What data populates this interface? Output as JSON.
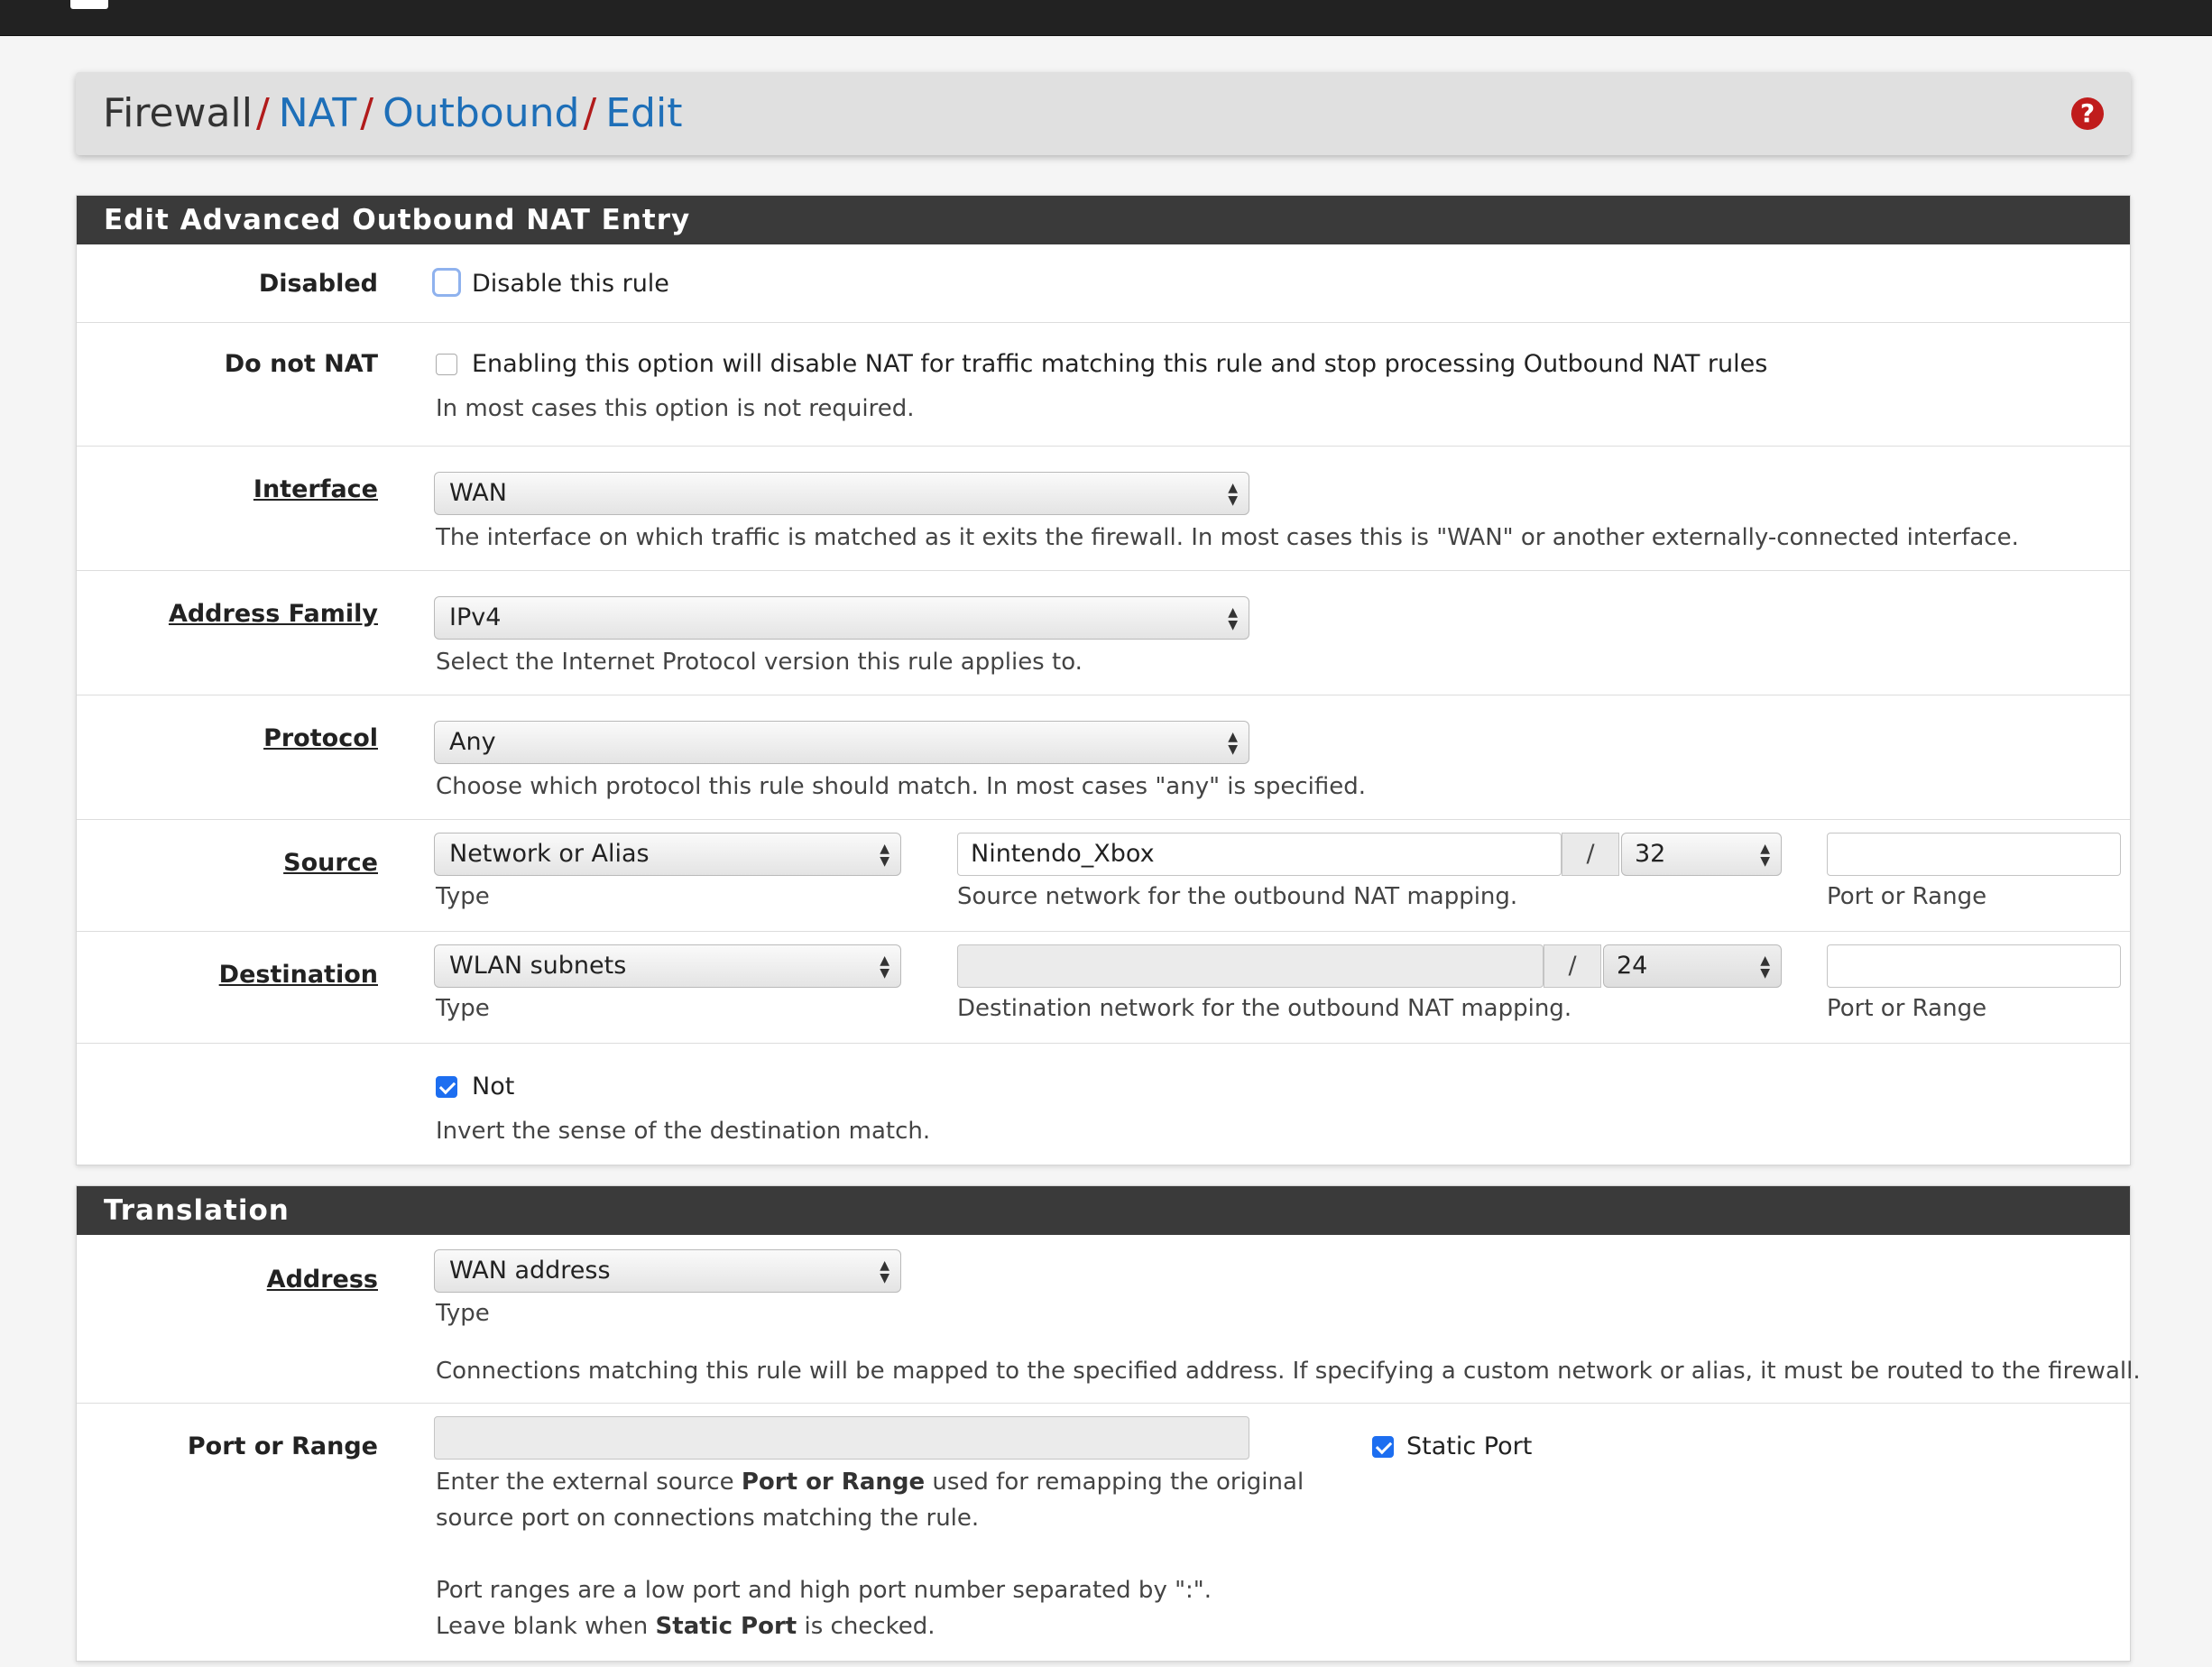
{
  "breadcrumb": {
    "items": [
      "Firewall",
      "NAT",
      "Outbound",
      "Edit"
    ],
    "separator": "/"
  },
  "panel_main": {
    "title": "Edit Advanced Outbound NAT Entry",
    "disabled": {
      "label": "Disabled",
      "checkbox_text": "Disable this rule",
      "checked": false
    },
    "nonat": {
      "label": "Do not NAT",
      "checkbox_text": "Enabling this option will disable NAT for traffic matching this rule and stop processing Outbound NAT rules",
      "help": "In most cases this option is not required.",
      "checked": false
    },
    "interface": {
      "label": "Interface",
      "value": "WAN",
      "help": "The interface on which traffic is matched as it exits the firewall. In most cases this is \"WAN\" or another externally-connected interface."
    },
    "address_family": {
      "label": "Address Family",
      "value": "IPv4",
      "help": "Select the Internet Protocol version this rule applies to."
    },
    "protocol": {
      "label": "Protocol",
      "value": "Any",
      "help": "Choose which protocol this rule should match. In most cases \"any\" is specified."
    },
    "source": {
      "label": "Source",
      "type_value": "Network or Alias",
      "type_help": "Type",
      "network_value": "Nintendo_Xbox",
      "slash": "/",
      "mask": "32",
      "network_help": "Source network for the outbound NAT mapping.",
      "port_value": "",
      "port_help": "Port or Range"
    },
    "destination": {
      "label": "Destination",
      "type_value": "WLAN subnets",
      "type_help": "Type",
      "network_value": "",
      "slash": "/",
      "mask": "24",
      "network_help": "Destination network for the outbound NAT mapping.",
      "port_value": "",
      "port_help": "Port or Range"
    },
    "not": {
      "checkbox_text": "Not",
      "checked": true,
      "help": "Invert the sense of the destination match."
    }
  },
  "panel_translation": {
    "title": "Translation",
    "address": {
      "label": "Address",
      "value": "WAN address",
      "type_help": "Type",
      "help": "Connections matching this rule will be mapped to the specified address. If specifying a custom network or alias, it must be routed to the firewall."
    },
    "port_range": {
      "label": "Port or Range",
      "value": "",
      "static_port_text": "Static Port",
      "static_port_checked": true,
      "help1_pre": "Enter the external source ",
      "help1_bold": "Port or Range",
      "help1_post": " used for remapping the original",
      "help2": "source port on connections matching the rule.",
      "help3": "Port ranges are a low port and high port number separated by \":\".",
      "help4_pre": "Leave blank when ",
      "help4_bold": "Static Port",
      "help4_post": " is checked."
    }
  },
  "colors": {
    "link": "#1e6fb8",
    "separator": "#b11b1b",
    "panel_heading": "#3a3a3a",
    "checkbox_checked": "#1d6ef0",
    "help_icon": "#c01c1c"
  },
  "icons": {
    "help": "question-circle-icon",
    "select": "updown-arrows-icon"
  }
}
